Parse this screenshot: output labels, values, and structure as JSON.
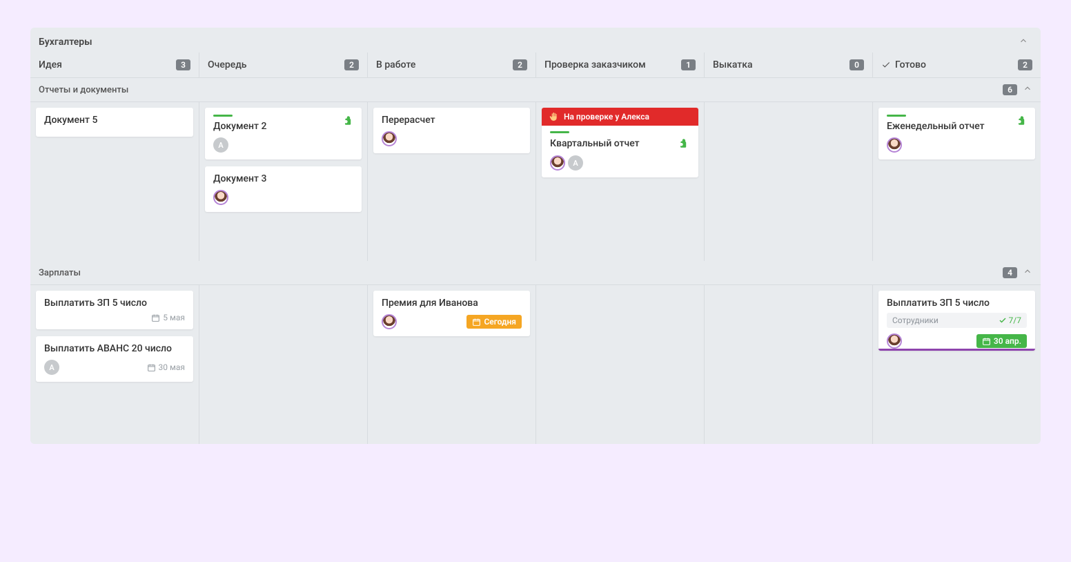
{
  "board": {
    "title": "Бухгалтеры",
    "columns": [
      {
        "label": "Идея",
        "count": "3",
        "done": false
      },
      {
        "label": "Очередь",
        "count": "2",
        "done": false
      },
      {
        "label": "В работе",
        "count": "2",
        "done": false
      },
      {
        "label": "Проверка заказчиком",
        "count": "1",
        "done": false
      },
      {
        "label": "Выкатка",
        "count": "0",
        "done": false
      },
      {
        "label": "Готово",
        "count": "2",
        "done": true
      }
    ],
    "swimlanes": [
      {
        "title": "Отчеты и документы",
        "count": "6",
        "cells": [
          [
            {
              "title": "Документ 5"
            }
          ],
          [
            {
              "title": "Документ 2",
              "stripe": true,
              "puzzle": true,
              "avatars": [
                "A"
              ]
            },
            {
              "title": "Документ 3",
              "avatars": [
                "img"
              ]
            }
          ],
          [
            {
              "title": "Перерасчет",
              "avatars": [
                "img"
              ]
            }
          ],
          [
            {
              "banner": "На проверке у Алекса",
              "title": "Квартальный отчет",
              "stripe": true,
              "puzzle_inline": true,
              "avatars": [
                "img",
                "A"
              ]
            }
          ],
          [],
          [
            {
              "title": "Еженедельный отчет",
              "stripe": true,
              "puzzle": true,
              "avatars": [
                "img"
              ]
            }
          ]
        ]
      },
      {
        "title": "Зарплаты",
        "count": "4",
        "cells": [
          [
            {
              "title": "Выплатить ЗП 5 число",
              "date_plain": "5 мая"
            },
            {
              "title": "Выплатить АВАНС 20 число",
              "avatars": [
                "A"
              ],
              "date_plain": "30 мая"
            }
          ],
          [],
          [
            {
              "title": "Премия для Иванова",
              "avatars": [
                "img"
              ],
              "date_orange": "Сегодня"
            }
          ],
          [],
          [],
          [
            {
              "title": "Выплатить ЗП 5 число",
              "sublabel": "Сотрудники",
              "subcount": "7/7",
              "avatars": [
                "img"
              ],
              "date_green": "30 апр.",
              "purple_underline": true
            }
          ]
        ]
      }
    ]
  }
}
